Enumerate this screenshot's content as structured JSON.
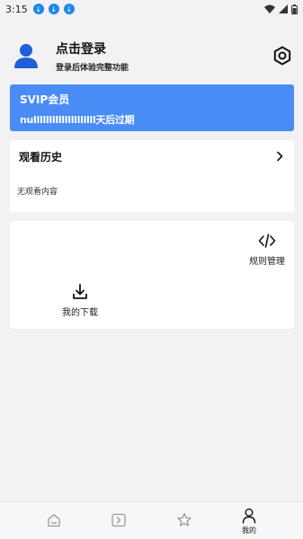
{
  "status_bar": {
    "time": "3:15",
    "badge_icon": "download-icon",
    "badge_count": 3
  },
  "profile": {
    "login_title": "点击登录",
    "login_subtitle": "登录后体验完整功能"
  },
  "vip": {
    "title": "SVIP会员",
    "expire_text": "nullllllllllllllllllll天后过期"
  },
  "history": {
    "title": "观看历史",
    "empty_text": "无观看内容"
  },
  "tools": {
    "rules_label": "规则管理",
    "downloads_label": "我的下载"
  },
  "bottom_nav": {
    "items": [
      {
        "icon": "home-icon",
        "label": ""
      },
      {
        "icon": "play-icon",
        "label": ""
      },
      {
        "icon": "star-icon",
        "label": ""
      },
      {
        "icon": "person-icon",
        "label": "我的"
      }
    ]
  },
  "colors": {
    "accent": "#4a8cf6",
    "avatar": "#1f5fd9",
    "page_bg": "#f2f2f4"
  }
}
